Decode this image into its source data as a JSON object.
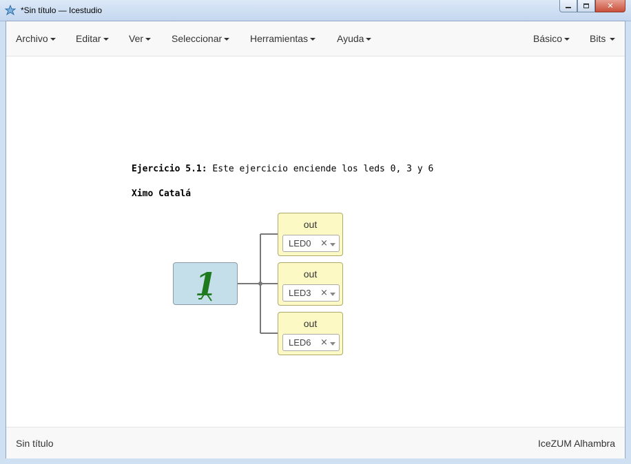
{
  "window": {
    "title": "*Sin título — Icestudio",
    "icon": "icestudio-icon",
    "controls": {
      "minimize": "minimize-icon",
      "maximize": "maximize-icon",
      "close": "close-icon"
    }
  },
  "menubar": {
    "left": [
      {
        "label": "Archivo"
      },
      {
        "label": "Editar"
      },
      {
        "label": "Ver"
      },
      {
        "label": "Seleccionar"
      },
      {
        "label": "Herramientas"
      },
      {
        "label": "Ayuda"
      }
    ],
    "right": [
      {
        "label": "Básico"
      },
      {
        "label": "Bits"
      }
    ]
  },
  "canvas": {
    "info": {
      "heading": "Ejercicio 5.1:",
      "text": " Este ejercicio enciende los leds 0, 3 y 6",
      "author": "Ximo Catalá"
    },
    "constant_block": {
      "icon": "constant-one-icon",
      "color": "#c5dfea"
    },
    "outputs": [
      {
        "label": "out",
        "pin": "LED0",
        "clear": "×"
      },
      {
        "label": "out",
        "pin": "LED3",
        "clear": "×"
      },
      {
        "label": "out",
        "pin": "LED6",
        "clear": "×"
      }
    ],
    "colors": {
      "output_block": "#fcf9c4",
      "wire": "#777777"
    }
  },
  "footer": {
    "left": "Sin título",
    "right": "IceZUM Alhambra"
  }
}
